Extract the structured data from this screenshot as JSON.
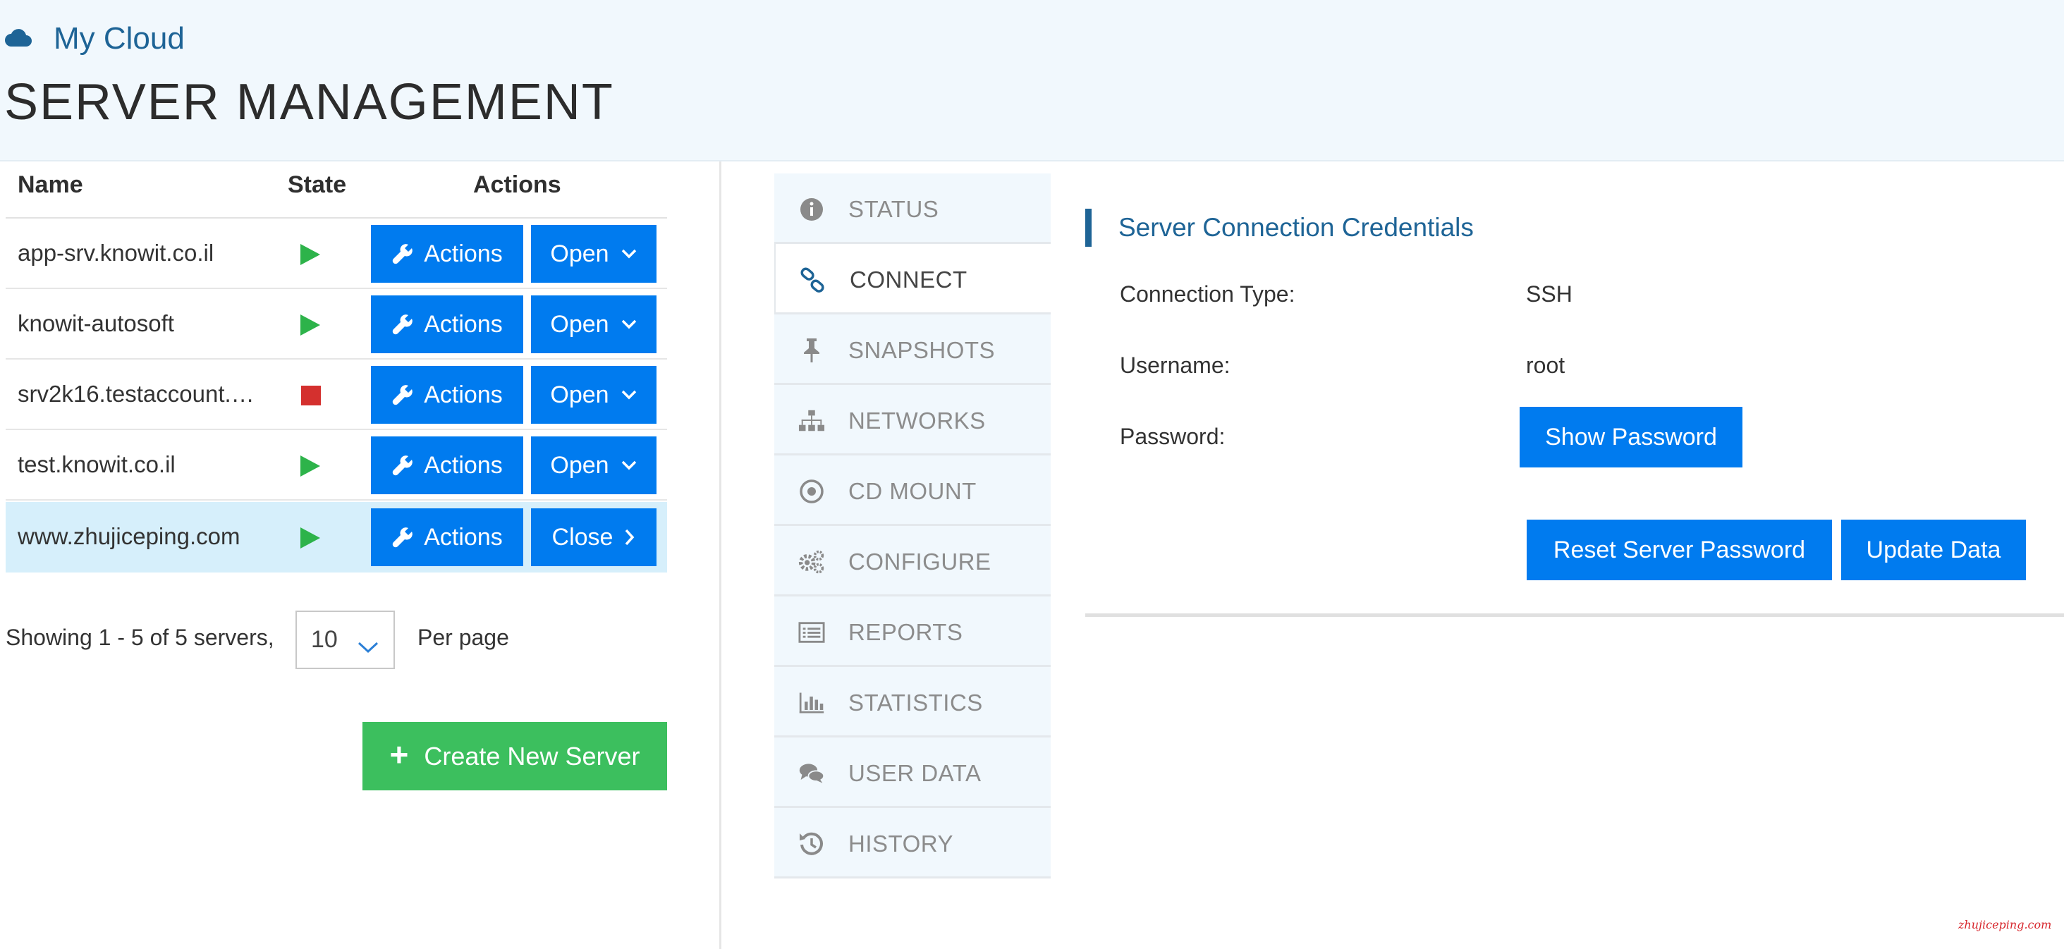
{
  "app": {
    "brand": "My Cloud",
    "title": "SERVER MANAGEMENT"
  },
  "table": {
    "headers": {
      "name": "Name",
      "state": "State",
      "actions": "Actions"
    },
    "rows": [
      {
        "name": "app-srv.knowit.co.il",
        "state": "running",
        "actions_label": "Actions",
        "toggle_label": "Open"
      },
      {
        "name": "knowit-autosoft",
        "state": "running",
        "actions_label": "Actions",
        "toggle_label": "Open"
      },
      {
        "name": "srv2k16.testaccount.…",
        "state": "stopped",
        "actions_label": "Actions",
        "toggle_label": "Open"
      },
      {
        "name": "test.knowit.co.il",
        "state": "running",
        "actions_label": "Actions",
        "toggle_label": "Open"
      },
      {
        "name": "www.zhujiceping.com",
        "state": "running",
        "actions_label": "Actions",
        "toggle_label": "Close"
      }
    ]
  },
  "pagination": {
    "summary": "Showing 1 - 5 of 5 servers,",
    "per_page_value": "10",
    "per_page_label": "Per page"
  },
  "create_button": "Create New Server",
  "tabs": [
    {
      "label": "STATUS",
      "icon": "info-icon"
    },
    {
      "label": "CONNECT",
      "icon": "link-icon"
    },
    {
      "label": "SNAPSHOTS",
      "icon": "pin-icon"
    },
    {
      "label": "NETWORKS",
      "icon": "sitemap-icon"
    },
    {
      "label": "CD MOUNT",
      "icon": "disc-icon"
    },
    {
      "label": "CONFIGURE",
      "icon": "gears-icon"
    },
    {
      "label": "REPORTS",
      "icon": "list-icon"
    },
    {
      "label": "STATISTICS",
      "icon": "bar-chart-icon"
    },
    {
      "label": "USER DATA",
      "icon": "comments-icon"
    },
    {
      "label": "HISTORY",
      "icon": "history-icon"
    }
  ],
  "active_tab": "CONNECT",
  "credentials": {
    "title": "Server Connection Credentials",
    "connection_type_label": "Connection Type:",
    "connection_type_value": "SSH",
    "username_label": "Username:",
    "username_value": "root",
    "password_label": "Password:",
    "show_password": "Show Password",
    "reset_password": "Reset Server Password",
    "update_data": "Update Data"
  },
  "watermark": "zhujiceping.com",
  "colors": {
    "primary": "#007bef",
    "success": "#3cbf5e",
    "brand": "#1e6496",
    "running": "#2db34a",
    "stopped": "#d4302e",
    "selected_row": "#d6effb"
  }
}
